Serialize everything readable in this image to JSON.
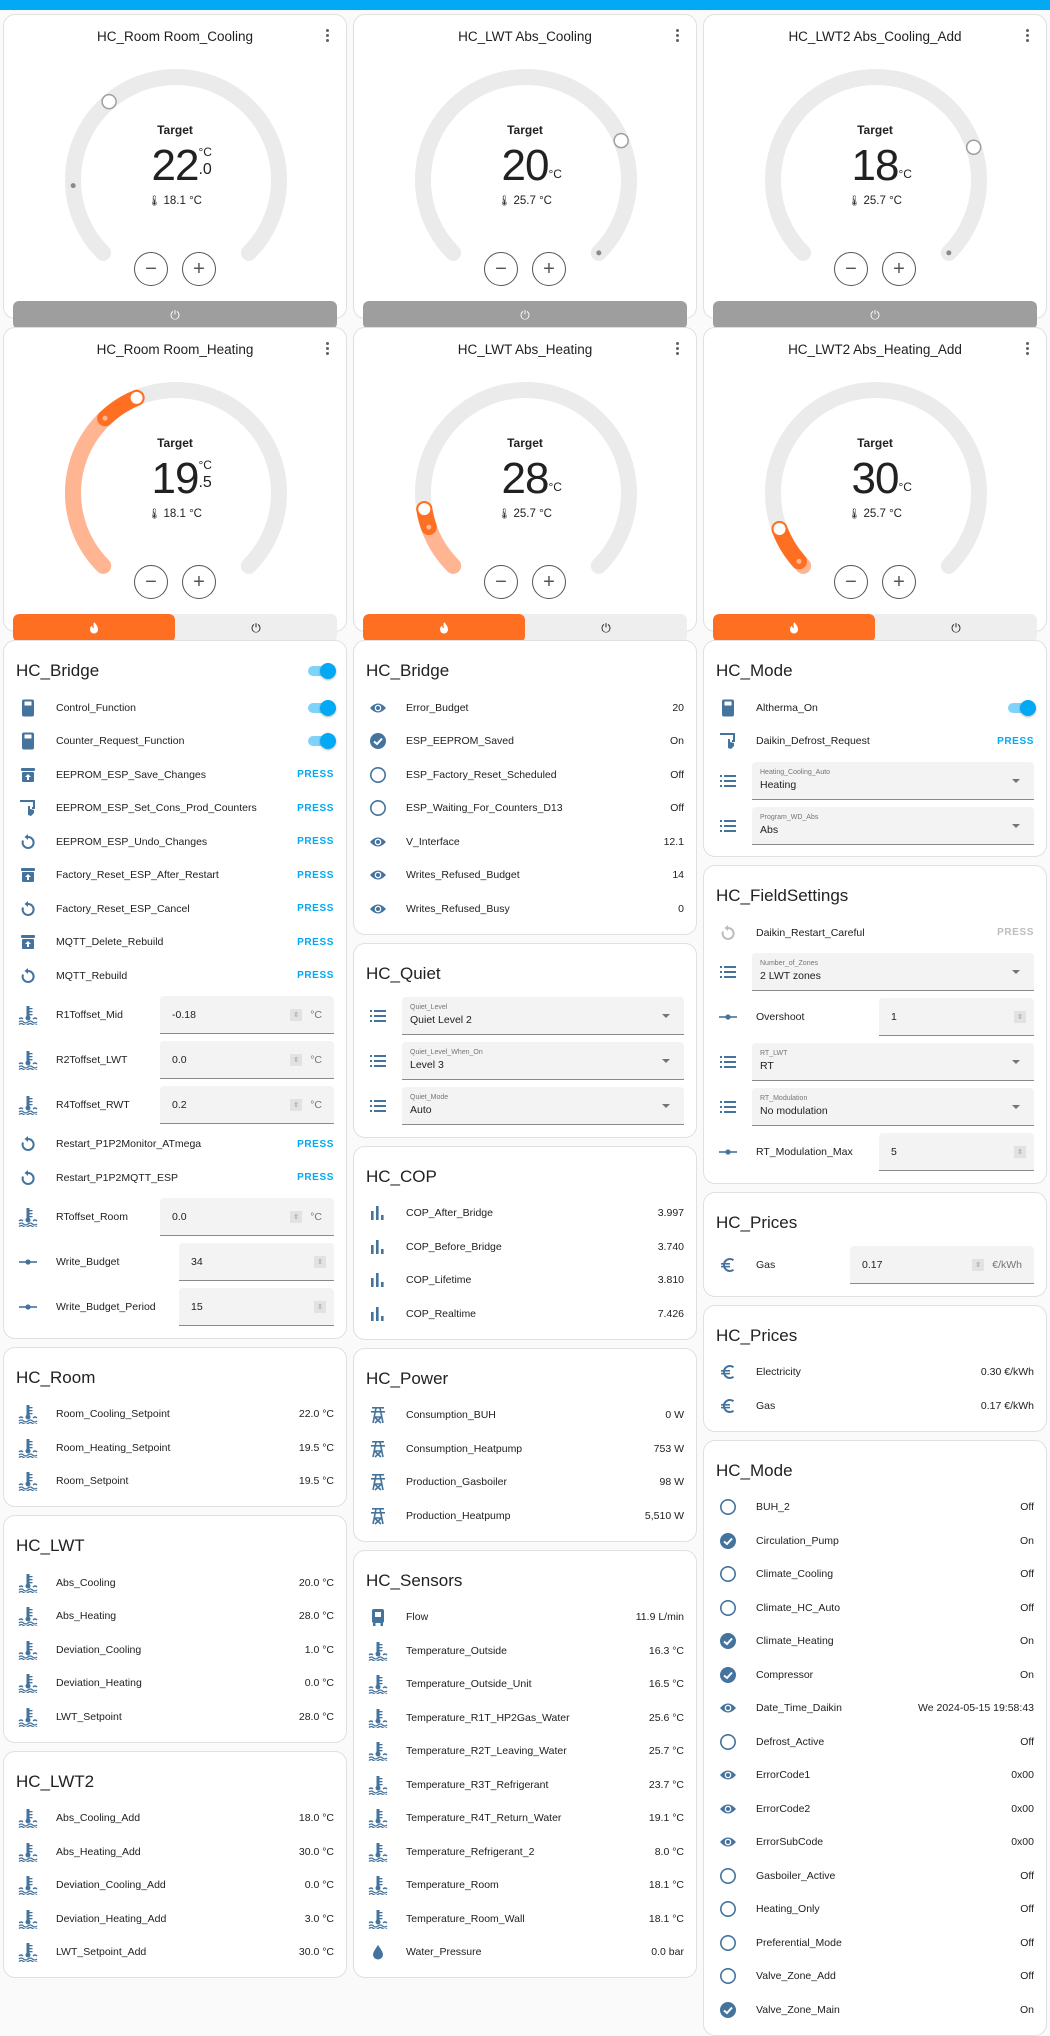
{
  "colors": {
    "header": "#03a9f4",
    "accent": "#03a9f4",
    "heat": "#ff6f22",
    "heat_light": "#ffb592",
    "icon": "#44739e",
    "off_bar": "#9e9e9e"
  },
  "thermostats": [
    {
      "title": "HC_Room Room_Cooling",
      "label": "Target",
      "target_int": "22",
      "target_dec": ".0",
      "unit": "°C",
      "current": "18.1 °C",
      "target": 22.0,
      "current_value": 18.1,
      "min": 15,
      "max": 35,
      "mode": "off",
      "active": false
    },
    {
      "title": "HC_LWT Abs_Cooling",
      "label": "Target",
      "target_int": "20",
      "target_dec": "",
      "unit": "°C",
      "current": "25.7 °C",
      "target": 20,
      "current_value": 25.7,
      "min": 5,
      "max": 25,
      "mode": "off",
      "active": false
    },
    {
      "title": "HC_LWT2 Abs_Cooling_Add",
      "label": "Target",
      "target_int": "18",
      "target_dec": "",
      "unit": "°C",
      "current": "25.7 °C",
      "target": 18,
      "current_value": 25.7,
      "min": 5,
      "max": 22,
      "mode": "off",
      "active": false
    },
    {
      "title": "HC_Room Room_Heating",
      "label": "Target",
      "target_int": "19",
      "target_dec": ".5",
      "unit": "°C",
      "current": "18.1 °C",
      "target": 19.5,
      "current_value": 18.1,
      "min": 12,
      "max": 30,
      "mode": "heat",
      "active": true
    },
    {
      "title": "HC_LWT Abs_Heating",
      "label": "Target",
      "target_int": "28",
      "target_dec": "",
      "unit": "°C",
      "current": "25.7 °C",
      "target": 28,
      "current_value": 25.7,
      "min": 20,
      "max": 80,
      "mode": "heat",
      "active": true
    },
    {
      "title": "HC_LWT2 Abs_Heating_Add",
      "label": "Target",
      "target_int": "30",
      "target_dec": "",
      "unit": "°C",
      "current": "25.7 °C",
      "target": 30,
      "current_value": 25.7,
      "min": 25,
      "max": 80,
      "mode": "heat",
      "active": true
    }
  ],
  "bridge_controls": {
    "title": "HC_Bridge",
    "rows": [
      {
        "icon": "toggle-switch-icon",
        "name": "Control_Function",
        "type": "toggle",
        "state": "on"
      },
      {
        "icon": "toggle-switch-icon",
        "name": "Counter_Request_Function",
        "type": "toggle",
        "state": "on"
      },
      {
        "icon": "archive-arrow-up-icon",
        "name": "EEPROM_ESP_Save_Changes",
        "type": "button",
        "action": "PRESS"
      },
      {
        "icon": "gesture-tap-icon",
        "name": "EEPROM_ESP_Set_Cons_Prod_Counters",
        "type": "button",
        "action": "PRESS"
      },
      {
        "icon": "restart-icon",
        "name": "EEPROM_ESP_Undo_Changes",
        "type": "button",
        "action": "PRESS"
      },
      {
        "icon": "archive-arrow-up-icon",
        "name": "Factory_Reset_ESP_After_Restart",
        "type": "button",
        "action": "PRESS"
      },
      {
        "icon": "restart-icon",
        "name": "Factory_Reset_ESP_Cancel",
        "type": "button",
        "action": "PRESS"
      },
      {
        "icon": "archive-arrow-up-icon",
        "name": "MQTT_Delete_Rebuild",
        "type": "button",
        "action": "PRESS"
      },
      {
        "icon": "restart-icon",
        "name": "MQTT_Rebuild",
        "type": "button",
        "action": "PRESS"
      },
      {
        "icon": "thermometer-water-icon",
        "name": "R1Toffset_Mid",
        "type": "number",
        "value": "-0.18",
        "unit": "°C"
      },
      {
        "icon": "thermometer-water-icon",
        "name": "R2Toffset_LWT",
        "type": "number",
        "value": "0.0",
        "unit": "°C"
      },
      {
        "icon": "thermometer-water-icon",
        "name": "R4Toffset_RWT",
        "type": "number",
        "value": "0.2",
        "unit": "°C"
      },
      {
        "icon": "restart-icon",
        "name": "Restart_P1P2Monitor_ATmega",
        "type": "button",
        "action": "PRESS"
      },
      {
        "icon": "restart-icon",
        "name": "Restart_P1P2MQTT_ESP",
        "type": "button",
        "action": "PRESS"
      },
      {
        "icon": "thermometer-water-icon",
        "name": "RToffset_Room",
        "type": "number",
        "value": "0.0",
        "unit": "°C"
      },
      {
        "icon": "ray-vertex-icon",
        "name": "Write_Budget",
        "type": "number-short",
        "value": "34",
        "unit": ""
      },
      {
        "icon": "ray-vertex-icon",
        "name": "Write_Budget_Period",
        "type": "number-short",
        "value": "15",
        "unit": ""
      }
    ]
  },
  "room": {
    "title": "HC_Room",
    "rows": [
      {
        "icon": "thermometer-water-icon",
        "name": "Room_Cooling_Setpoint",
        "value": "22.0 °C"
      },
      {
        "icon": "thermometer-water-icon",
        "name": "Room_Heating_Setpoint",
        "value": "19.5 °C"
      },
      {
        "icon": "thermometer-water-icon",
        "name": "Room_Setpoint",
        "value": "19.5 °C"
      }
    ]
  },
  "lwt": {
    "title": "HC_LWT",
    "rows": [
      {
        "icon": "thermometer-water-icon",
        "name": "Abs_Cooling",
        "value": "20.0 °C"
      },
      {
        "icon": "thermometer-water-icon",
        "name": "Abs_Heating",
        "value": "28.0 °C"
      },
      {
        "icon": "thermometer-water-icon",
        "name": "Deviation_Cooling",
        "value": "1.0 °C"
      },
      {
        "icon": "thermometer-water-icon",
        "name": "Deviation_Heating",
        "value": "0.0 °C"
      },
      {
        "icon": "thermometer-water-icon",
        "name": "LWT_Setpoint",
        "value": "28.0 °C"
      }
    ]
  },
  "lwt2": {
    "title": "HC_LWT2",
    "rows": [
      {
        "icon": "thermometer-water-icon",
        "name": "Abs_Cooling_Add",
        "value": "18.0 °C"
      },
      {
        "icon": "thermometer-water-icon",
        "name": "Abs_Heating_Add",
        "value": "30.0 °C"
      },
      {
        "icon": "thermometer-water-icon",
        "name": "Deviation_Cooling_Add",
        "value": "0.0 °C"
      },
      {
        "icon": "thermometer-water-icon",
        "name": "Deviation_Heating_Add",
        "value": "3.0 °C"
      },
      {
        "icon": "thermometer-water-icon",
        "name": "LWT_Setpoint_Add",
        "value": "30.0 °C"
      }
    ]
  },
  "bridge_status": {
    "title": "HC_Bridge",
    "rows": [
      {
        "icon": "eye-icon",
        "name": "Error_Budget",
        "value": "20"
      },
      {
        "icon": "checkbox-marked-circle-icon",
        "name": "ESP_EEPROM_Saved",
        "value": "On"
      },
      {
        "icon": "checkbox-blank-circle-outline-icon",
        "name": "ESP_Factory_Reset_Scheduled",
        "value": "Off"
      },
      {
        "icon": "checkbox-blank-circle-outline-icon",
        "name": "ESP_Waiting_For_Counters_D13",
        "value": "Off"
      },
      {
        "icon": "eye-icon",
        "name": "V_Interface",
        "value": "12.1"
      },
      {
        "icon": "eye-icon",
        "name": "Writes_Refused_Budget",
        "value": "14"
      },
      {
        "icon": "eye-icon",
        "name": "Writes_Refused_Busy",
        "value": "0"
      }
    ]
  },
  "quiet": {
    "title": "HC_Quiet",
    "selects": [
      {
        "icon": "format-list-bulleted-icon",
        "label": "Quiet_Level",
        "value": "Quiet Level 2"
      },
      {
        "icon": "format-list-bulleted-icon",
        "label": "Quiet_Level_When_On",
        "value": "Level 3"
      },
      {
        "icon": "format-list-bulleted-icon",
        "label": "Quiet_Mode",
        "value": "Auto"
      }
    ]
  },
  "cop": {
    "title": "HC_COP",
    "rows": [
      {
        "icon": "chart-bar-icon",
        "name": "COP_After_Bridge",
        "value": "3.997"
      },
      {
        "icon": "chart-bar-icon",
        "name": "COP_Before_Bridge",
        "value": "3.740"
      },
      {
        "icon": "chart-bar-icon",
        "name": "COP_Lifetime",
        "value": "3.810"
      },
      {
        "icon": "chart-bar-icon",
        "name": "COP_Realtime",
        "value": "7.426"
      }
    ]
  },
  "power": {
    "title": "HC_Power",
    "rows": [
      {
        "icon": "transmission-tower-icon",
        "name": "Consumption_BUH",
        "value": "0 W"
      },
      {
        "icon": "transmission-tower-icon",
        "name": "Consumption_Heatpump",
        "value": "753 W"
      },
      {
        "icon": "transmission-tower-icon",
        "name": "Production_Gasboiler",
        "value": "98 W"
      },
      {
        "icon": "transmission-tower-icon",
        "name": "Production_Heatpump",
        "value": "5,510 W"
      }
    ]
  },
  "sensors": {
    "title": "HC_Sensors",
    "rows": [
      {
        "icon": "water-pump-icon",
        "name": "Flow",
        "value": "11.9 L/min"
      },
      {
        "icon": "thermometer-water-icon",
        "name": "Temperature_Outside",
        "value": "16.3 °C"
      },
      {
        "icon": "thermometer-water-icon",
        "name": "Temperature_Outside_Unit",
        "value": "16.5 °C"
      },
      {
        "icon": "thermometer-water-icon",
        "name": "Temperature_R1T_HP2Gas_Water",
        "value": "25.6 °C"
      },
      {
        "icon": "thermometer-water-icon",
        "name": "Temperature_R2T_Leaving_Water",
        "value": "25.7 °C"
      },
      {
        "icon": "thermometer-water-icon",
        "name": "Temperature_R3T_Refrigerant",
        "value": "23.7 °C"
      },
      {
        "icon": "thermometer-water-icon",
        "name": "Temperature_R4T_Return_Water",
        "value": "19.1 °C"
      },
      {
        "icon": "thermometer-water-icon",
        "name": "Temperature_Refrigerant_2",
        "value": "8.0 °C"
      },
      {
        "icon": "thermometer-water-icon",
        "name": "Temperature_Room",
        "value": "18.1 °C"
      },
      {
        "icon": "thermometer-water-icon",
        "name": "Temperature_Room_Wall",
        "value": "18.1 °C"
      },
      {
        "icon": "water-drop-icon",
        "name": "Water_Pressure",
        "value": "0.0 bar"
      }
    ]
  },
  "mode_controls": {
    "title": "HC_Mode",
    "header_toggle": "on",
    "rows": [
      {
        "icon": "toggle-switch-icon",
        "name": "Altherma_On",
        "type": "toggle",
        "state": "on"
      },
      {
        "icon": "gesture-tap-icon",
        "name": "Daikin_Defrost_Request",
        "type": "button",
        "action": "PRESS"
      }
    ],
    "selects": [
      {
        "icon": "format-list-bulleted-icon",
        "label": "Heating_Cooling_Auto",
        "value": "Heating"
      },
      {
        "icon": "format-list-bulleted-icon",
        "label": "Program_WD_Abs",
        "value": "Abs"
      }
    ]
  },
  "fieldsettings": {
    "title": "HC_FieldSettings",
    "restart": {
      "icon": "restart-icon",
      "name": "Daikin_Restart_Careful",
      "action": "PRESS",
      "disabled": true
    },
    "zones": {
      "icon": "format-list-bulleted-icon",
      "label": "Number_of_Zones",
      "value": "2 LWT zones"
    },
    "overshoot": {
      "icon": "ray-vertex-icon",
      "name": "Overshoot",
      "value": "1"
    },
    "rt_lwt": {
      "icon": "format-list-bulleted-icon",
      "label": "RT_LWT",
      "value": "RT"
    },
    "rt_mod": {
      "icon": "format-list-bulleted-icon",
      "label": "RT_Modulation",
      "value": "No modulation"
    },
    "rt_mod_max": {
      "icon": "ray-vertex-icon",
      "name": "RT_Modulation_Max",
      "value": "5"
    }
  },
  "prices_input": {
    "title": "HC_Prices",
    "row": {
      "icon": "currency-eur-icon",
      "name": "Gas",
      "value": "0.17",
      "unit": "€/kWh"
    }
  },
  "prices": {
    "title": "HC_Prices",
    "rows": [
      {
        "icon": "currency-eur-icon",
        "name": "Electricity",
        "value": "0.30 €/kWh"
      },
      {
        "icon": "currency-eur-icon",
        "name": "Gas",
        "value": "0.17 €/kWh"
      }
    ]
  },
  "mode_status": {
    "title": "HC_Mode",
    "rows": [
      {
        "icon": "checkbox-blank-circle-outline-icon",
        "name": "BUH_2",
        "value": "Off"
      },
      {
        "icon": "checkbox-marked-circle-icon",
        "name": "Circulation_Pump",
        "value": "On"
      },
      {
        "icon": "checkbox-blank-circle-outline-icon",
        "name": "Climate_Cooling",
        "value": "Off"
      },
      {
        "icon": "checkbox-blank-circle-outline-icon",
        "name": "Climate_HC_Auto",
        "value": "Off"
      },
      {
        "icon": "checkbox-marked-circle-icon",
        "name": "Climate_Heating",
        "value": "On"
      },
      {
        "icon": "checkbox-marked-circle-icon",
        "name": "Compressor",
        "value": "On"
      },
      {
        "icon": "eye-icon",
        "name": "Date_Time_Daikin",
        "value": "We 2024-05-15 19:58:43"
      },
      {
        "icon": "checkbox-blank-circle-outline-icon",
        "name": "Defrost_Active",
        "value": "Off"
      },
      {
        "icon": "eye-icon",
        "name": "ErrorCode1",
        "value": "0x00"
      },
      {
        "icon": "eye-icon",
        "name": "ErrorCode2",
        "value": "0x00"
      },
      {
        "icon": "eye-icon",
        "name": "ErrorSubCode",
        "value": "0x00"
      },
      {
        "icon": "checkbox-blank-circle-outline-icon",
        "name": "Gasboiler_Active",
        "value": "Off"
      },
      {
        "icon": "checkbox-blank-circle-outline-icon",
        "name": "Heating_Only",
        "value": "Off"
      },
      {
        "icon": "checkbox-blank-circle-outline-icon",
        "name": "Preferential_Mode",
        "value": "Off"
      },
      {
        "icon": "checkbox-blank-circle-outline-icon",
        "name": "Valve_Zone_Add",
        "value": "Off"
      },
      {
        "icon": "checkbox-marked-circle-icon",
        "name": "Valve_Zone_Main",
        "value": "On"
      }
    ]
  }
}
